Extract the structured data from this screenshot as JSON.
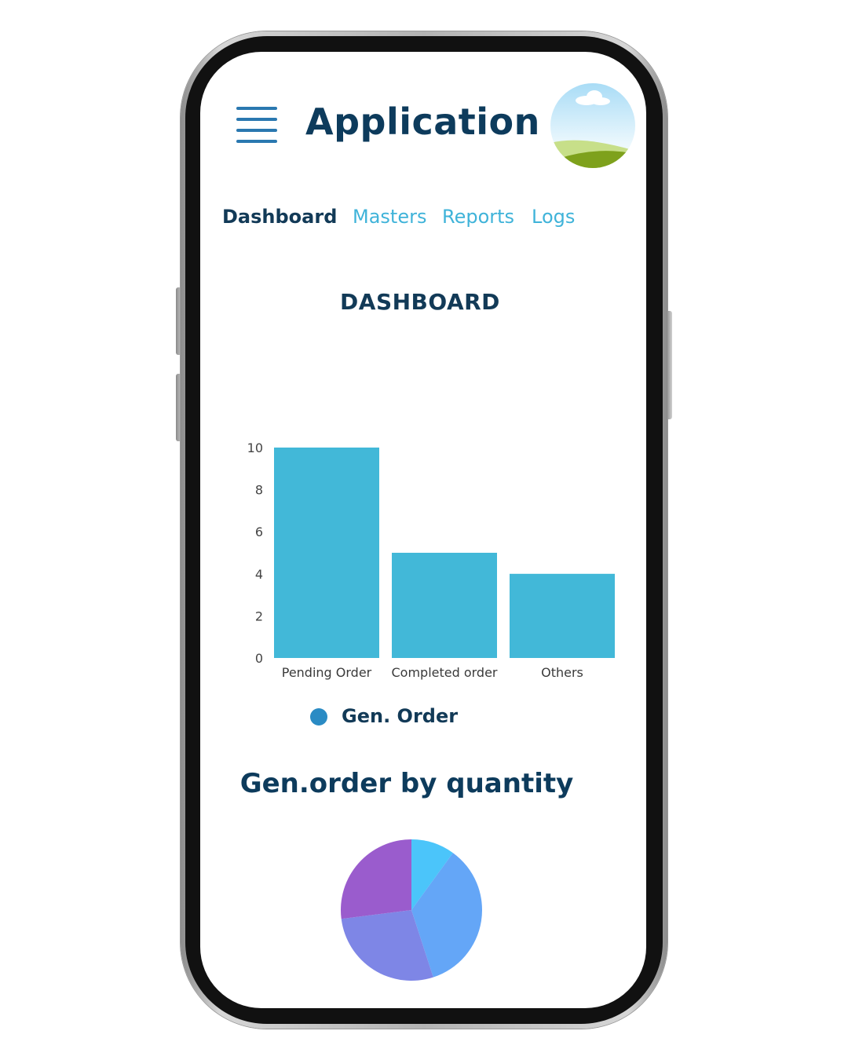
{
  "header": {
    "title": "Application",
    "menu_icon": "hamburger-menu-icon",
    "avatar": "landscape-avatar"
  },
  "nav": {
    "items": [
      {
        "label": "Dashboard",
        "active": true
      },
      {
        "label": "Masters",
        "active": false
      },
      {
        "label": "Reports",
        "active": false
      },
      {
        "label": "Logs",
        "active": false
      }
    ]
  },
  "dashboard": {
    "title": "DASHBOARD",
    "legend_label": "Gen. Order",
    "pie_title": "Gen.order by quantity"
  },
  "colors": {
    "accent": "#42b8d8",
    "title": "#0d3b5c",
    "nav_link": "#3fb3d9",
    "legend_dot": "#2a8bc4"
  },
  "chart_data": [
    {
      "type": "bar",
      "categories": [
        "Pending Order",
        "Completed order",
        "Others"
      ],
      "series": [
        {
          "name": "Gen. Order",
          "values": [
            10,
            5,
            4
          ]
        }
      ],
      "yticks": [
        0,
        2,
        4,
        6,
        8,
        10
      ],
      "ylim": [
        0,
        10
      ],
      "grid": false,
      "legend": "bottom",
      "color": "#42b8d8"
    },
    {
      "type": "pie",
      "values": [
        10,
        35,
        28,
        27
      ],
      "colors": [
        "#4bc5fa",
        "#64a6f7",
        "#7e86e6",
        "#9a5ccd"
      ],
      "legend": "none"
    }
  ]
}
